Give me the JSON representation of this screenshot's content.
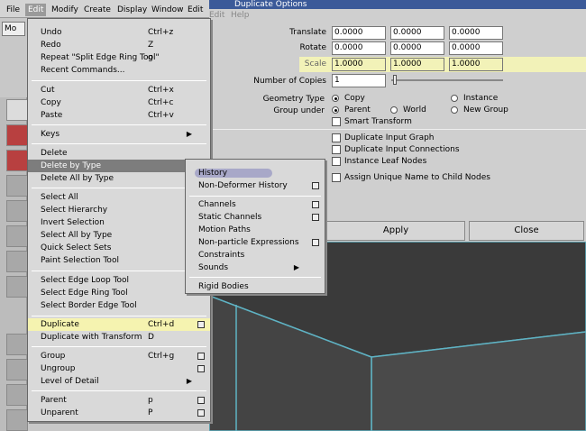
{
  "menubar": {
    "items": [
      "File",
      "Edit",
      "Modify",
      "Create",
      "Display",
      "Window",
      "Edit"
    ],
    "selected": "Edit",
    "panel_field": "Mo"
  },
  "dialog": {
    "title": "Duplicate Options",
    "menu": [
      "Edit",
      "Help"
    ],
    "translate": {
      "label": "Translate",
      "values": [
        "0.0000",
        "0.0000",
        "0.0000"
      ]
    },
    "rotate": {
      "label": "Rotate",
      "values": [
        "0.0000",
        "0.0000",
        "0.0000"
      ]
    },
    "scale": {
      "label": "Scale",
      "values": [
        "1.0000",
        "1.0000",
        "1.0000"
      ]
    },
    "copies": {
      "label": "Number of Copies",
      "value": "1"
    },
    "geometry": {
      "label": "Geometry Type",
      "copy": "Copy",
      "instance": "Instance"
    },
    "group": {
      "label": "Group under",
      "parent": "Parent",
      "world": "World",
      "new_group": "New Group"
    },
    "smart_transform": "Smart Transform",
    "dup_input_graph": "Duplicate Input Graph",
    "dup_input_conn": "Duplicate Input Connections",
    "instance_leaf": "Instance Leaf Nodes",
    "assign_unique": "Assign Unique Name to Child Nodes",
    "apply": "Apply",
    "close": "Close"
  },
  "edit_menu": [
    {
      "label": "Undo",
      "sc": "Ctrl+z"
    },
    {
      "label": "Redo",
      "sc": "Z"
    },
    {
      "label": "Repeat \"Split Edge Ring Tool\"",
      "sc": "g"
    },
    {
      "label": "Recent Commands..."
    },
    {
      "label": "Cut",
      "sc": "Ctrl+x"
    },
    {
      "label": "Copy",
      "sc": "Ctrl+c"
    },
    {
      "label": "Paste",
      "sc": "Ctrl+v"
    },
    {
      "label": "Keys"
    },
    {
      "label": "Delete"
    },
    {
      "label": "Delete by Type"
    },
    {
      "label": "Delete All by Type"
    },
    {
      "label": "Select All"
    },
    {
      "label": "Select Hierarchy"
    },
    {
      "label": "Invert Selection"
    },
    {
      "label": "Select All by Type"
    },
    {
      "label": "Quick Select Sets"
    },
    {
      "label": "Paint Selection Tool"
    },
    {
      "label": "Select Edge Loop Tool"
    },
    {
      "label": "Select Edge Ring Tool"
    },
    {
      "label": "Select Border Edge Tool"
    },
    {
      "label": "Duplicate",
      "sc": "Ctrl+d"
    },
    {
      "label": "Duplicate with Transform",
      "sc": "D"
    },
    {
      "label": "Group",
      "sc": "Ctrl+g"
    },
    {
      "label": "Ungroup"
    },
    {
      "label": "Level of Detail"
    },
    {
      "label": "Parent",
      "sc": "p"
    },
    {
      "label": "Unparent",
      "sc": "P"
    }
  ],
  "submenu": [
    {
      "label": "History"
    },
    {
      "label": "Non-Deformer History"
    },
    {
      "label": "Channels"
    },
    {
      "label": "Static Channels"
    },
    {
      "label": "Motion Paths"
    },
    {
      "label": "Non-particle Expressions"
    },
    {
      "label": "Constraints"
    },
    {
      "label": "Sounds"
    },
    {
      "label": "Rigid Bodies"
    }
  ]
}
